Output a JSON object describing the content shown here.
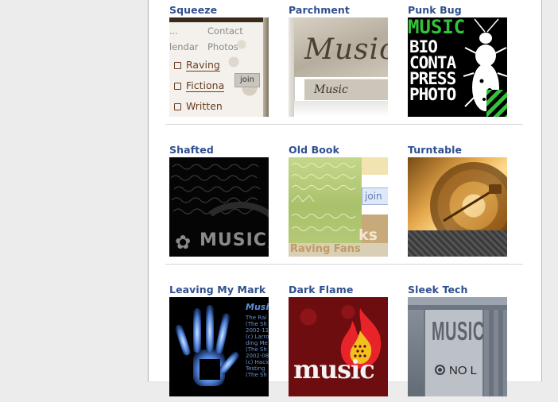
{
  "themes": [
    {
      "title": "Squeeze",
      "preview": {
        "nav": [
          "Contact",
          "Photos"
        ],
        "nav_partial": [
          "...",
          "lendar"
        ],
        "list": [
          "Raving",
          "Fictiona",
          "Written"
        ],
        "join": "join"
      }
    },
    {
      "title": "Parchment",
      "preview": {
        "big_word": "Music",
        "ribbon": "Music"
      }
    },
    {
      "title": "Punk Bug",
      "preview": {
        "green_word": "MUSIC",
        "lines": [
          "BIO",
          "CONTA",
          "PRESS",
          "PHOTO"
        ]
      }
    },
    {
      "title": "Shafted",
      "preview": {
        "word": "MUSIC"
      }
    },
    {
      "title": "Old Book",
      "preview": {
        "join": "join",
        "partial": "ks",
        "footer": "Raving Fans"
      }
    },
    {
      "title": "Turntable",
      "preview": {}
    },
    {
      "title": "Leaving My Mark",
      "preview": {
        "header": "Musi",
        "lines": [
          "The Rai",
          "(The Sh",
          "2002-11-",
          "(c) Larro",
          "ding Me",
          "(The Sh",
          "2002-08-",
          "(c) Hacio",
          "Testing",
          "(The Sh"
        ]
      }
    },
    {
      "title": "Dark Flame",
      "preview": {
        "word": "music"
      }
    },
    {
      "title": "Sleek Tech",
      "preview": {
        "word": "MUSIC",
        "sub": "NO L"
      }
    }
  ],
  "colors": {
    "title": "#2f4f8f",
    "divider": "#d6d6d6"
  }
}
